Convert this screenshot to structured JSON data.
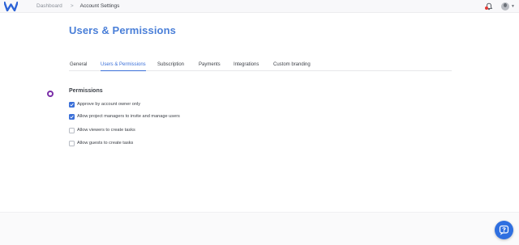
{
  "topbar": {
    "logo_icon": "w-logo-icon",
    "breadcrumb": {
      "items": [
        "Dashboard",
        "Account Settings"
      ],
      "separator": ">"
    },
    "notification_icon": "bell-icon",
    "notification_dot_color": "#e53935",
    "avatar_icon": "user-avatar"
  },
  "main": {
    "title": "Users & Permissions",
    "title_color": "#4a7fd8",
    "tabs": [
      {
        "label": "General",
        "active": false
      },
      {
        "label": "Users & Permissions",
        "active": true
      },
      {
        "label": "Subscription",
        "active": false
      },
      {
        "label": "Payments",
        "active": false
      },
      {
        "label": "Integrations",
        "active": false
      },
      {
        "label": "Custom branding",
        "active": false
      }
    ],
    "accent_color": "#3a6fd8",
    "permissions": {
      "title": "Permissions",
      "options": [
        {
          "label": "Approve by account owner only",
          "checked": true
        },
        {
          "label": "Allow project managers to invite and manage users",
          "checked": true
        },
        {
          "label": "Allow viewers to create tasks",
          "checked": false
        },
        {
          "label": "Allow guests to create tasks",
          "checked": false
        }
      ]
    }
  },
  "chat_widget": {
    "icon": "chat-help-icon",
    "color": "#2f6fe0"
  }
}
